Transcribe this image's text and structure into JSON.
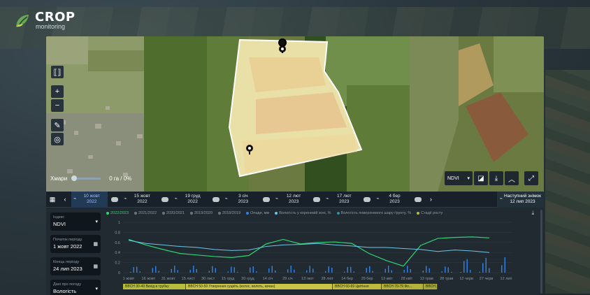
{
  "brand": {
    "name": "CROP",
    "sub": "monitoring"
  },
  "map": {
    "clouds_label": "Хмари",
    "clouds_value": "0 га / 0%",
    "index_select": "NDVI"
  },
  "timeline": {
    "items": [
      {
        "date": "10 жовт",
        "year": "2022",
        "active": true
      },
      {
        "date": "15 жовт",
        "year": "2022"
      },
      {
        "date": "19 груд",
        "year": "2022"
      },
      {
        "date": "3 січ",
        "year": "2023"
      },
      {
        "date": "12 лют",
        "year": "2023"
      },
      {
        "date": "17 лют",
        "year": "2023"
      },
      {
        "date": "4 бер",
        "year": "2023"
      }
    ],
    "next_label": "Наступний знімок",
    "next_date": "12 лип 2023"
  },
  "sidebar": {
    "index_label": "Індекс",
    "index_value": "NDVI",
    "start_label": "Початок періоду",
    "start_value": "1 жовт 2022",
    "end_label": "Кінець періоду",
    "end_value": "24 лип 2023",
    "weather_label": "Дані про погоду",
    "weather_value": "Вологість"
  },
  "legend": [
    "2022/2023",
    "2021/2022",
    "2020/2021",
    "2019/2020",
    "2018/2019",
    "Опади, мм",
    "Вологість у кореневій зоні, %",
    "Вологість поверхневого шару ґрунту, %",
    "Стадії росту"
  ],
  "phases": [
    {
      "label": "BBCH 30-49 Вихід в трубку",
      "color": "#b8bc3d"
    },
    {
      "label": "BBCH 50-59 Утворення суцвіть (колос, волоть, качан)",
      "color": "#c9c447"
    },
    {
      "label": "BBCH 60-69 Цвітіння",
      "color": "#bfba3e"
    },
    {
      "label": "BBCH 70-79 Фо...",
      "color": "#b3b13a"
    },
    {
      "label": "BBCH...",
      "color": "#a9a836"
    }
  ],
  "chart_data": {
    "type": "line",
    "x": [
      "1 жовт",
      "16 жовт",
      "31 жовт",
      "15 лист",
      "30 лист",
      "15 груд",
      "30 груд",
      "14 січ",
      "29 січ",
      "13 лют",
      "28 лют",
      "14 бер",
      "29 бер",
      "13 квіт",
      "28 квіт",
      "13 трав",
      "28 трав",
      "12 черв",
      "27 черв",
      "12 лип"
    ],
    "ylim": [
      0,
      1
    ],
    "yticks": [
      "0",
      "0.2",
      "0.4",
      "0.6",
      "0.8",
      "1"
    ],
    "series": [
      {
        "name": "2022/2023",
        "color": "#2ed573",
        "values": [
          0.66,
          0.55,
          0.46,
          0.38,
          0.35,
          0.32,
          0.3,
          0.34,
          0.57,
          0.66,
          0.57,
          0.6,
          0.61,
          0.58,
          0.38,
          0.24,
          0.13,
          0.54,
          0.68,
          0.7,
          0.71,
          0.69
        ]
      },
      {
        "name": "Вологість у кореневій зоні, %",
        "color": "#6ec6e8",
        "values": [
          0.64,
          0.58,
          0.55,
          0.52,
          0.5,
          0.46,
          0.44,
          0.45,
          0.52,
          0.55,
          0.56,
          0.58,
          0.55,
          0.53,
          0.5,
          0.5,
          0.48,
          0.46,
          0.42,
          0.45,
          0.43,
          0.4
        ]
      }
    ],
    "bars": {
      "name": "Опади, мм",
      "color": "#2f7fe0"
    }
  }
}
